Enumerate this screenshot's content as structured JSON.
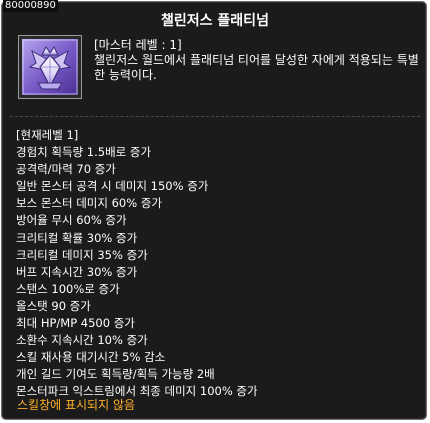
{
  "tooltip": {
    "item_id": "80000890",
    "title": "챌린저스 플래티넘",
    "icon": "platinum-crystal-icon",
    "master_level": "[마스터 레벨 : 1]",
    "description": "챌린저스 월드에서 플래티넘 티어를 달성한 자에게 적용되는 특별한 능력이다.",
    "current_level": "[현재레벨 1]",
    "stats": [
      "경험치 획득량 1.5배로 증가",
      "공격력/마력 70 증가",
      "일반 몬스터 공격 시 데미지 150% 증가",
      "보스 몬스터  데미지 60% 증가",
      "방어율 무시 60% 증가",
      "크리티컬 확률 30% 증가",
      "크리티컬 데미지 35% 증가",
      "버프 지속시간 30% 증가",
      "스탠스 100%로 증가",
      "올스탯 90 증가",
      "최대 HP/MP 4500 증가",
      "소환수 지속시간 10% 증가",
      "스킬 재사용 대기시간 5% 감소",
      "개인 길드 기여도 획득량/획득 가능량 2배",
      "몬스터파크 익스트림에서 최종 데미지 100% 증가"
    ],
    "note": "스킬창에 표시되지 않음",
    "colors": {
      "background": "#1b1b1b",
      "border": "#6e6e6e",
      "text": "#ffffff",
      "note": "#ffb028",
      "icon_purple": "#7a5cc8"
    }
  }
}
